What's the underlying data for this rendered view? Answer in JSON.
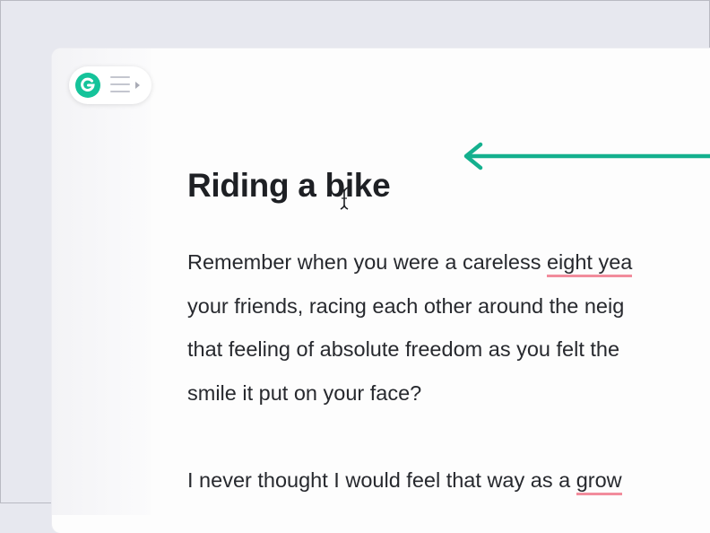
{
  "widget": {
    "logo_letter": "G",
    "logo_color": "#15c39a",
    "menu_icon": "hamburger-menu-icon"
  },
  "pointer": {
    "icon": "left-arrow-icon",
    "color": "#14b08e"
  },
  "document": {
    "title": "Riding a bike",
    "paragraphs": [
      {
        "lines": [
          {
            "before": "Remember when you were a careless ",
            "flagged": "eight yea",
            "after": ""
          },
          {
            "before": "your friends, racing each other around the neig",
            "flagged": "",
            "after": ""
          },
          {
            "before": "that feeling of absolute freedom as you felt the",
            "flagged": "",
            "after": ""
          },
          {
            "before": "smile it put on your face?",
            "flagged": "",
            "after": ""
          }
        ]
      },
      {
        "lines": [
          {
            "before": "I never thought I would feel that way as a ",
            "flagged": "grow",
            "after": ""
          }
        ]
      }
    ],
    "underline_color": "#f28c9c"
  }
}
